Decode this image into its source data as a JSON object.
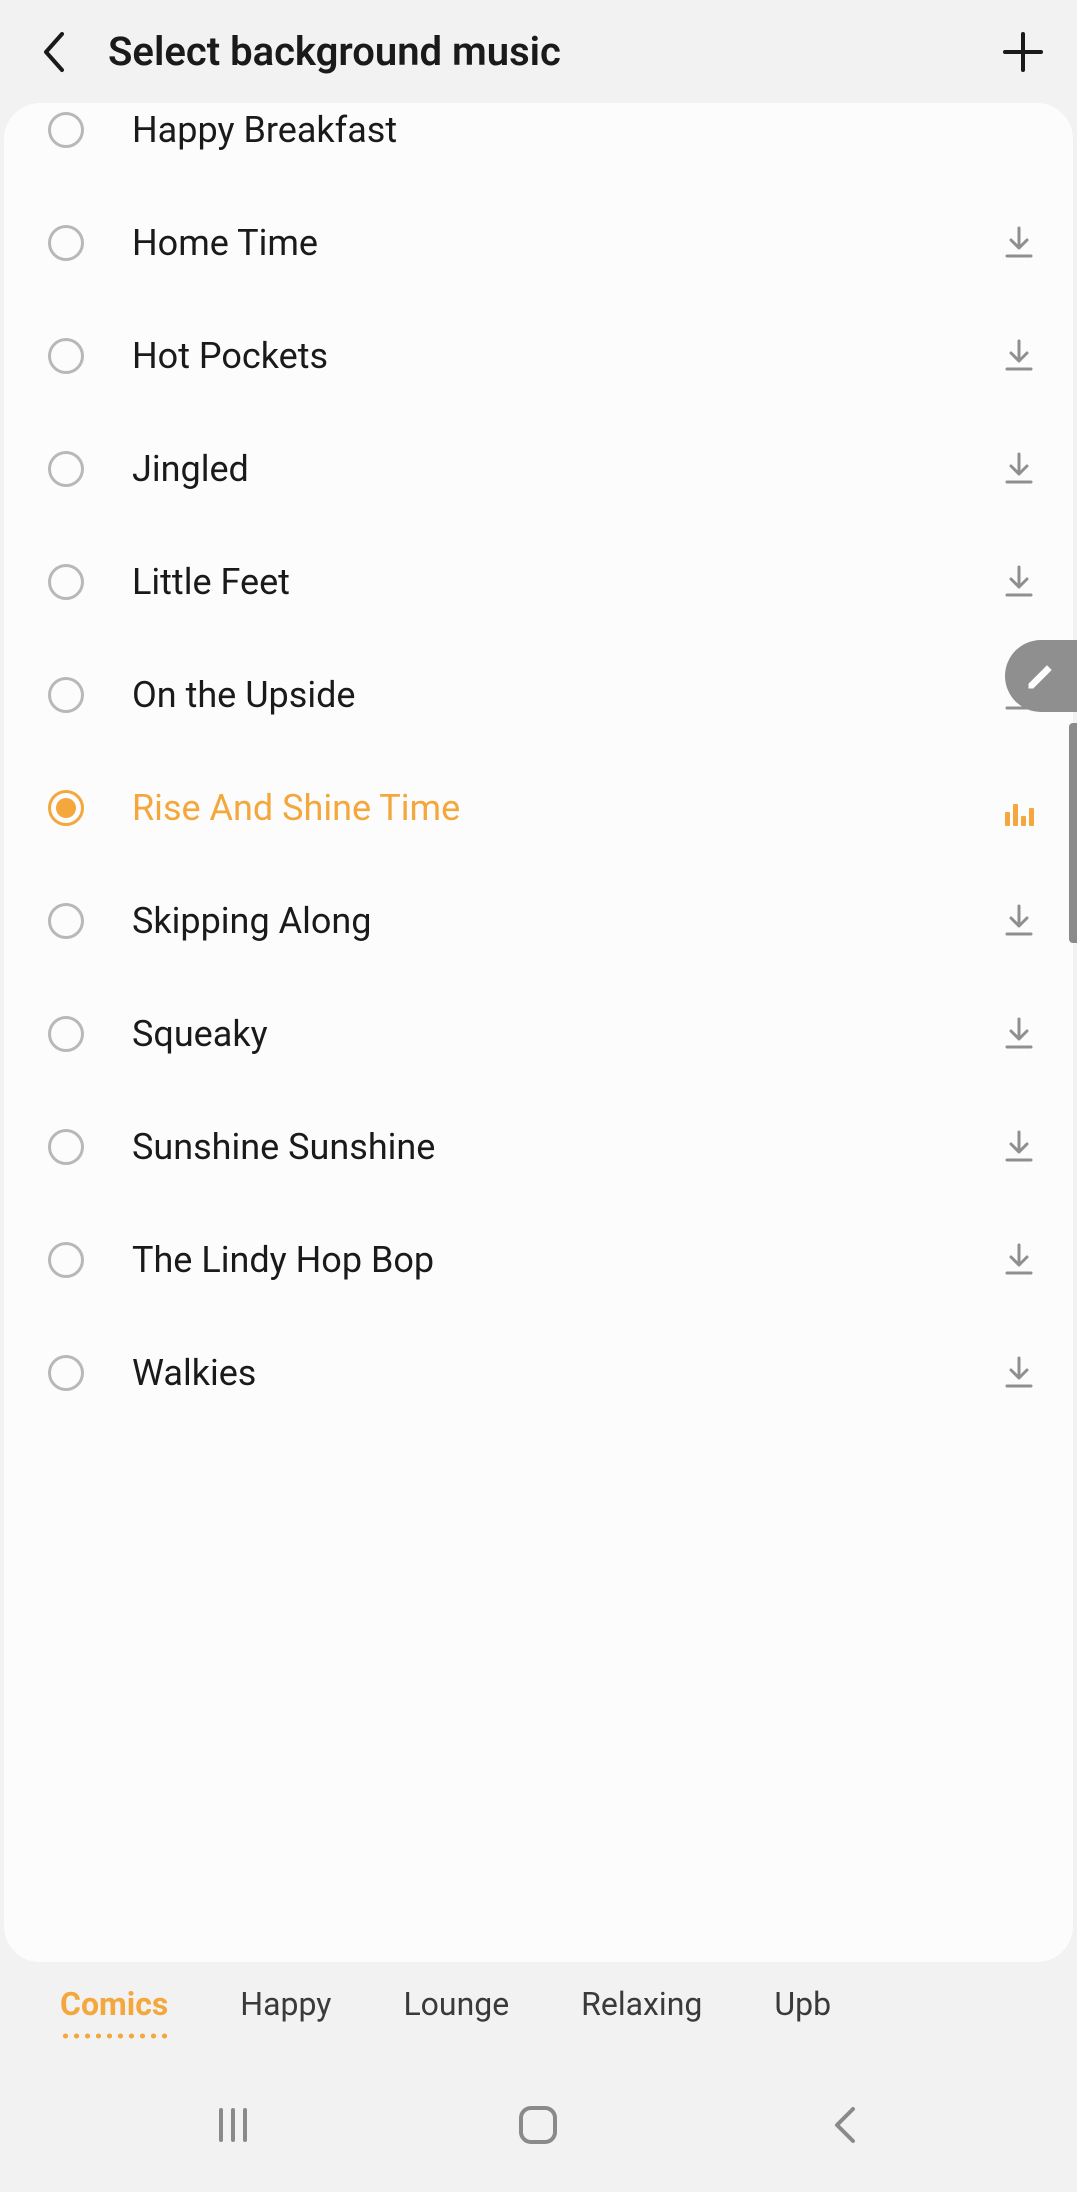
{
  "header": {
    "title": "Select background music"
  },
  "tracks": [
    {
      "label": "Happy Breakfast",
      "selected": false,
      "downloadable": false,
      "playing": false
    },
    {
      "label": "Home Time",
      "selected": false,
      "downloadable": true,
      "playing": false
    },
    {
      "label": "Hot Pockets",
      "selected": false,
      "downloadable": true,
      "playing": false
    },
    {
      "label": "Jingled",
      "selected": false,
      "downloadable": true,
      "playing": false
    },
    {
      "label": "Little Feet",
      "selected": false,
      "downloadable": true,
      "playing": false
    },
    {
      "label": "On the Upside",
      "selected": false,
      "downloadable": true,
      "playing": false
    },
    {
      "label": "Rise And Shine Time",
      "selected": true,
      "downloadable": false,
      "playing": true
    },
    {
      "label": "Skipping Along",
      "selected": false,
      "downloadable": true,
      "playing": false
    },
    {
      "label": "Squeaky",
      "selected": false,
      "downloadable": true,
      "playing": false
    },
    {
      "label": "Sunshine Sunshine",
      "selected": false,
      "downloadable": true,
      "playing": false
    },
    {
      "label": "The Lindy Hop Bop",
      "selected": false,
      "downloadable": true,
      "playing": false
    },
    {
      "label": "Walkies",
      "selected": false,
      "downloadable": true,
      "playing": false
    }
  ],
  "tabs": [
    {
      "label": "Comics",
      "active": true
    },
    {
      "label": "Happy",
      "active": false
    },
    {
      "label": "Lounge",
      "active": false
    },
    {
      "label": "Relaxing",
      "active": false
    },
    {
      "label": "Upb",
      "active": false
    }
  ],
  "colors": {
    "accent": "#f3a73d",
    "text": "#1a1a1a",
    "muted": "#8f8f8f"
  }
}
